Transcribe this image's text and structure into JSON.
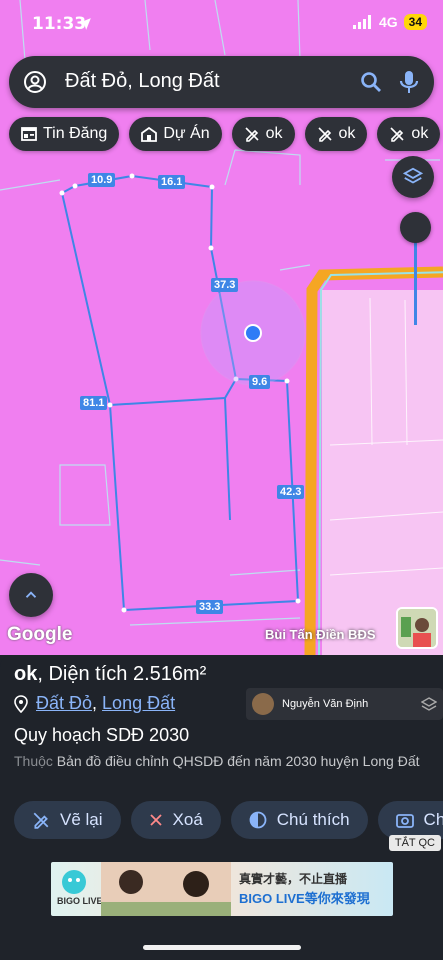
{
  "status": {
    "time": "11:33",
    "network": "4G",
    "battery": "34"
  },
  "search": {
    "query": "Đất Đỏ, Long Đất"
  },
  "chips": [
    {
      "label": "Tin Đăng",
      "icon": "listing-icon"
    },
    {
      "label": "Dự Án",
      "icon": "project-icon"
    },
    {
      "label": "ok",
      "icon": "pencil-off-icon"
    },
    {
      "label": "ok",
      "icon": "pencil-off-icon"
    },
    {
      "label": "ok",
      "icon": "pencil-off-icon"
    }
  ],
  "map": {
    "edge_labels": [
      "10.9",
      "16.1",
      "37.3",
      "9.6",
      "81.1",
      "42.3",
      "33.3"
    ],
    "attribution": "Google",
    "owner": "Bùi Tấn Điền BĐS",
    "colors": {
      "land": "#f07ff0",
      "road": "#f5a623",
      "parcel_line": "#3f86e6"
    }
  },
  "panel": {
    "name": "ok",
    "area_label": ", Diện tích ",
    "area_value": "2.516m²",
    "loc_district": "Đất Đỏ",
    "loc_separator": ", ",
    "loc_province": "Long Đất",
    "plan_title": "Quy hoạch SDĐ 2030",
    "plan_prefix": "Thuộc",
    "plan_desc": " Bản đồ điều chỉnh QHSDĐ đến năm 2030 huyện Long Đất",
    "user_name": "Nguyễn Văn Định"
  },
  "actions": [
    {
      "label": "Vẽ lại",
      "icon": "pencil-off-icon"
    },
    {
      "label": "Xoá",
      "icon": "close-icon"
    },
    {
      "label": "Chú thích",
      "icon": "legend-icon"
    },
    {
      "label": "Ch",
      "icon": "camera-icon"
    }
  ],
  "tat_qc": "TẮT QC",
  "ad": {
    "brand": "BIGO LIVE",
    "line1": "真實才藝，不止直播",
    "line2": "BIGO LIVE等你來發現"
  }
}
